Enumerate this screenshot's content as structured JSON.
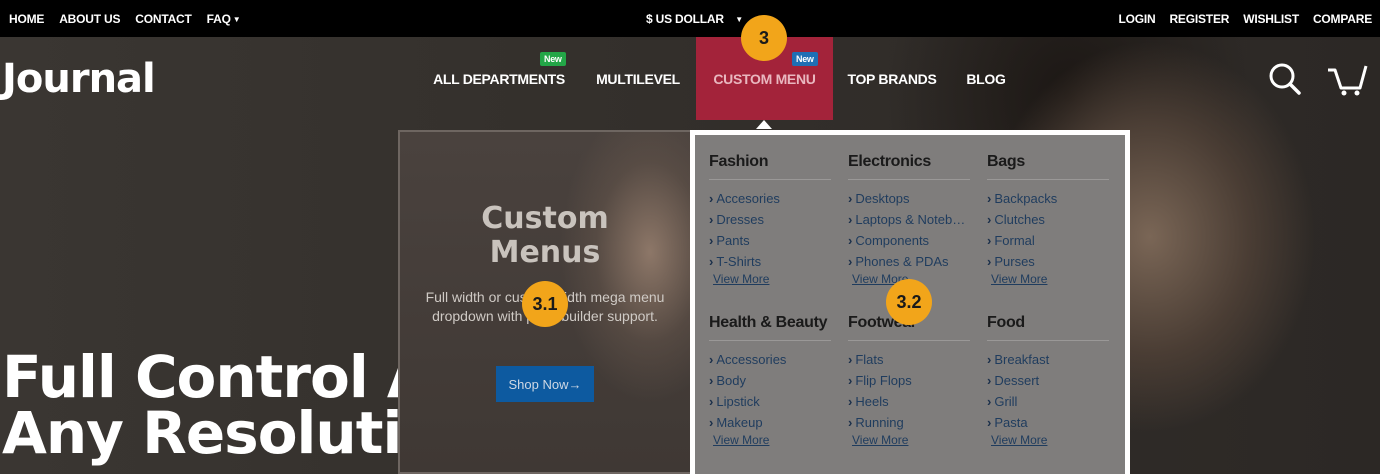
{
  "topbar": {
    "left_links": [
      "HOME",
      "ABOUT US",
      "CONTACT",
      "FAQ"
    ],
    "currency": "$ US DOLLAR",
    "right_links": [
      "LOGIN",
      "REGISTER",
      "WISHLIST",
      "COMPARE"
    ]
  },
  "logo": "Journal",
  "nav": {
    "items": [
      {
        "label": "ALL DEPARTMENTS",
        "badge": "New"
      },
      {
        "label": "MULTILEVEL"
      },
      {
        "label": "CUSTOM MENU",
        "badge": "New"
      },
      {
        "label": "TOP BRANDS"
      },
      {
        "label": "BLOG"
      }
    ]
  },
  "icons": [
    "search-icon",
    "cart-icon"
  ],
  "hero": {
    "line1": "Full Control A",
    "line2": "Any Resoluti"
  },
  "card": {
    "title1": "Custom",
    "title2": "Menus",
    "text": "Full width or custom width mega menu dropdown with page builder support.",
    "button": "Shop Now"
  },
  "menu": {
    "columns": [
      {
        "title": "Fashion",
        "items": [
          "Accesories",
          "Dresses",
          "Pants",
          "T-Shirts"
        ],
        "more": "View More"
      },
      {
        "title": "Electronics",
        "items": [
          "Desktops",
          "Laptops & Notebooks",
          "Components",
          "Phones & PDAs"
        ],
        "more": "View More"
      },
      {
        "title": "Bags",
        "items": [
          "Backpacks",
          "Clutches",
          "Formal",
          "Purses"
        ],
        "more": "View More"
      },
      {
        "title": "Health & Beauty",
        "items": [
          "Accessories",
          "Body",
          "Lipstick",
          "Makeup"
        ],
        "more": "View More"
      },
      {
        "title": "Footwear",
        "items": [
          "Flats",
          "Flip Flops",
          "Heels",
          "Running"
        ],
        "more": "View More"
      },
      {
        "title": "Food",
        "items": [
          "Breakfast",
          "Dessert",
          "Grill",
          "Pasta"
        ],
        "more": "View More"
      }
    ]
  },
  "callouts": [
    "3",
    "3.1",
    "3.2"
  ],
  "colors": {
    "topbar": "#000000",
    "active_nav": "#a3233a",
    "callout": "#f2a51a",
    "button": "#0d5aa0",
    "badge_green": "#23a647",
    "badge_blue": "#1f6fb5"
  }
}
